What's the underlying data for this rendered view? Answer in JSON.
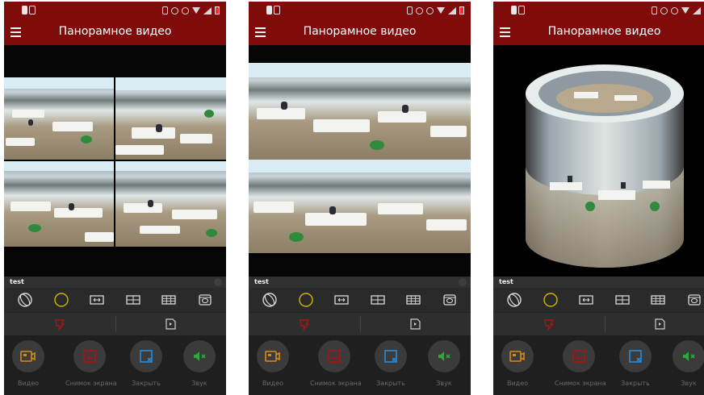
{
  "screens": [
    {
      "title": "Панорамное видео",
      "device_name": "test",
      "view_mode": "quad-split",
      "actions": [
        {
          "label": "Видео",
          "icon": "video-icon"
        },
        {
          "label": "Снимок экрана",
          "icon": "screenshot-icon"
        },
        {
          "label": "Закрыть",
          "icon": "close-square-icon"
        },
        {
          "label": "Звук",
          "icon": "sound-muted-icon"
        }
      ]
    },
    {
      "title": "Панорамное видео",
      "device_name": "test",
      "view_mode": "dual-panorama",
      "actions": [
        {
          "label": "Видео",
          "icon": "video-icon"
        },
        {
          "label": "Снимок экрана",
          "icon": "screenshot-icon"
        },
        {
          "label": "Закрыть",
          "icon": "close-square-icon"
        },
        {
          "label": "Звук",
          "icon": "sound-muted-icon"
        }
      ]
    },
    {
      "title": "Панорамное видео",
      "device_name": "test",
      "view_mode": "cylinder",
      "actions": [
        {
          "label": "Видео",
          "icon": "video-icon"
        },
        {
          "label": "Снимок экрана",
          "icon": "screenshot-icon"
        },
        {
          "label": "Закрыть",
          "icon": "close-square-icon"
        },
        {
          "label": "Звук",
          "icon": "sound-muted-icon"
        }
      ]
    }
  ],
  "mode_icons": [
    "sphere-icon",
    "fisheye-circle-icon",
    "panorama-expand-icon",
    "split-two-icon",
    "split-four-icon",
    "cylinder-icon"
  ],
  "colors": {
    "appbar": "#7f0b0b",
    "accent_yellow": "#d4b400",
    "record_red": "#a51414",
    "video_orange": "#d88a19",
    "close_blue": "#2a8bd8",
    "sound_green": "#2aa93c"
  }
}
